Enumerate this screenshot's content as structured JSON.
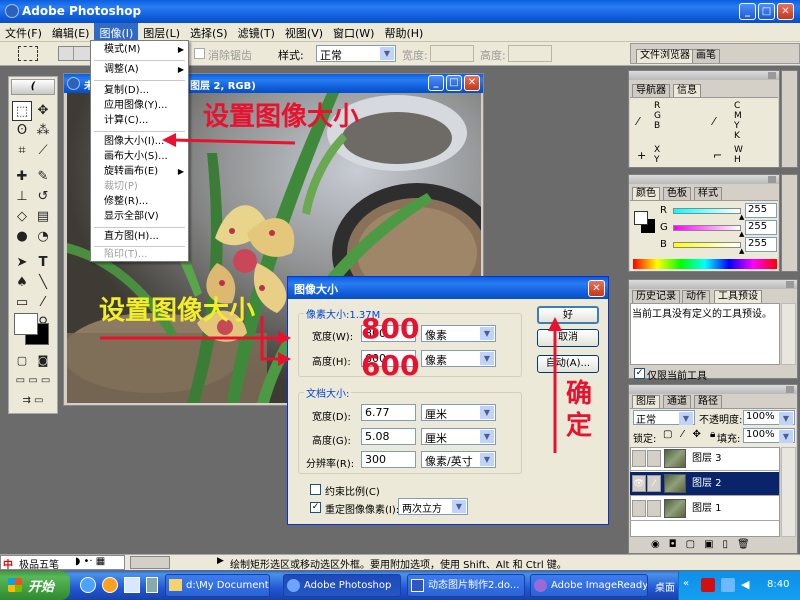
{
  "window": {
    "title": "Adobe Photoshop",
    "menu": [
      "文件(F)",
      "编辑(E)",
      "图像(I)",
      "图层(L)",
      "选择(S)",
      "滤镜(T)",
      "视图(V)",
      "窗口(W)",
      "帮助(H)"
    ]
  },
  "options": {
    "antialias_label": "消除锯齿",
    "style_label": "样式:",
    "style_value": "正常",
    "width_label": "宽度:",
    "height_label": "高度:",
    "tab_file_browser": "文件浏览器",
    "tab_brushes": "画笔"
  },
  "document": {
    "title_left": "未",
    "title_right": "图层 2, RGB)"
  },
  "image_menu": {
    "items": [
      {
        "label": "模式(M)",
        "submenu": true,
        "disabled": false
      },
      {
        "label": "调整(A)",
        "submenu": true,
        "disabled": false
      },
      {
        "label": "复制(D)...",
        "submenu": false,
        "disabled": false
      },
      {
        "label": "应用图像(Y)...",
        "submenu": false,
        "disabled": false
      },
      {
        "label": "计算(C)...",
        "submenu": false,
        "disabled": false
      },
      {
        "label": "图像大小(I)...",
        "submenu": false,
        "disabled": false
      },
      {
        "label": "画布大小(S)...",
        "submenu": false,
        "disabled": false
      },
      {
        "label": "旋转画布(E)",
        "submenu": true,
        "disabled": false
      },
      {
        "label": "裁切(P)",
        "submenu": false,
        "disabled": true
      },
      {
        "label": "修整(R)...",
        "submenu": false,
        "disabled": false
      },
      {
        "label": "显示全部(V)",
        "submenu": false,
        "disabled": false
      },
      {
        "label": "直方图(H)...",
        "submenu": false,
        "disabled": false
      },
      {
        "label": "陷印(T)...",
        "submenu": false,
        "disabled": true
      }
    ]
  },
  "navigator": {
    "tabs": [
      "导航器",
      "信息"
    ],
    "rgb_letters": "R\nG\nB",
    "cmyk_letters": "C\nM\nY\nK",
    "xy_letters": "X\nY",
    "wh_letters": "W\nH"
  },
  "color": {
    "tabs": [
      "颜色",
      "色板",
      "样式"
    ],
    "r_label": "R",
    "g_label": "G",
    "b_label": "B",
    "r": "255",
    "g": "255",
    "b": "255",
    "r_level": 1.0,
    "g_level": 1.0,
    "b_level": 1.0
  },
  "history": {
    "tabs": [
      "历史记录",
      "动作",
      "工具预设"
    ],
    "message": "当前工具没有定义的工具预设。",
    "current_tool_label": "仅限当前工具",
    "current_tool_checked": true
  },
  "layers": {
    "tabs": [
      "图层",
      "通道",
      "路径"
    ],
    "blend_mode": "正常",
    "opacity_label": "不透明度:",
    "opacity": "100%",
    "lock_label": "锁定:",
    "fill_label": "填充:",
    "fill": "100%",
    "items": [
      {
        "name": "图层 3",
        "visible": false,
        "selected": false
      },
      {
        "name": "图层 2",
        "visible": true,
        "selected": true
      },
      {
        "name": "图层 1",
        "visible": false,
        "selected": false
      }
    ]
  },
  "dialog": {
    "title": "图像大小",
    "pixel_group": "像素大小:1.37M",
    "width_label": "宽度(W):",
    "width_value": "800",
    "height_label": "高度(H):",
    "height_value": "600",
    "pixel_unit": "像素",
    "doc_group": "文档大小:",
    "doc_width_label": "宽度(D):",
    "doc_width_value": "6.77",
    "doc_height_label": "高度(G):",
    "doc_height_value": "5.08",
    "unit_cm": "厘米",
    "resolution_label": "分辨率(R):",
    "resolution_value": "300",
    "resolution_unit": "像素/英寸",
    "constrain_label": "约束比例(C)",
    "constrain_checked": false,
    "resample_label": "重定图像像素(I):",
    "resample_checked": true,
    "resample_method": "两次立方",
    "ok": "好",
    "cancel": "取消",
    "auto": "自动(A)..."
  },
  "annotations": {
    "menu_note": "设置图像大小",
    "dialog_note": "设置图像大小",
    "width_big": "800",
    "height_big": "600",
    "confirm": "确\n定",
    "menu_color": "#e8122e",
    "dialog_color": "#f2ee2a"
  },
  "status": {
    "ime": "极品五笔",
    "hint": "绘制矩形选区或移动选区外框。要用附加选项，使用 Shift、Alt 和 Ctrl 键。"
  },
  "taskbar": {
    "start": "开始",
    "tasks": [
      {
        "label": "d:\\My Documents\\...",
        "active": false
      },
      {
        "label": "Adobe Photoshop",
        "active": true
      },
      {
        "label": "动态图片制作2.do...",
        "active": false
      },
      {
        "label": "Adobe ImageReady",
        "active": false
      }
    ],
    "desktop": "桌面",
    "clock": "8:40"
  }
}
